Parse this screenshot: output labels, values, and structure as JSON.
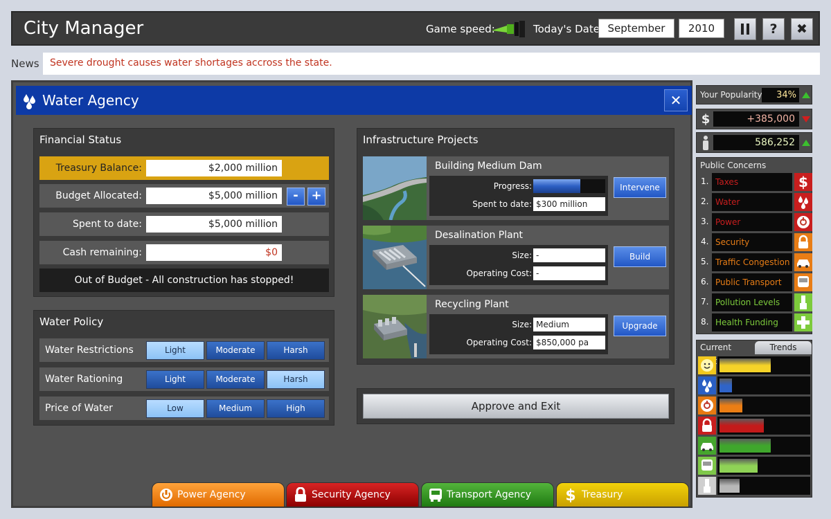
{
  "header": {
    "title": "City Manager",
    "speed_label": "Game speed:",
    "date_label": "Today's Date:",
    "month": "September",
    "year": "2010",
    "pause_icon": "pause-icon",
    "help_label": "?",
    "close_label": "✖"
  },
  "news": {
    "label": "News",
    "text": "Severe drought causes water shortages accross the state."
  },
  "agency": {
    "title": "Water Agency",
    "icon": "water-drops-icon",
    "close_label": "✕",
    "financial": {
      "title": "Financial Status",
      "rows": [
        {
          "label": "Treasury Balance:",
          "value": "$2,000 million"
        },
        {
          "label": "Budget Allocated:",
          "value": "$5,000 million"
        },
        {
          "label": "Spent to date:",
          "value": "$5,000 million"
        },
        {
          "label": "Cash remaining:",
          "value": "$0"
        }
      ],
      "minus_label": "-",
      "plus_label": "+",
      "status_message": "Out of Budget - All construction has stopped!"
    },
    "policy": {
      "title": "Water Policy",
      "rows": [
        {
          "label": "Water Restrictions",
          "options": [
            "Light",
            "Moderate",
            "Harsh"
          ],
          "selected": 0
        },
        {
          "label": "Water Rationing",
          "options": [
            "Light",
            "Moderate",
            "Harsh"
          ],
          "selected": 2
        },
        {
          "label": "Price of Water",
          "options": [
            "Low",
            "Medium",
            "High"
          ],
          "selected": 0
        }
      ]
    },
    "infrastructure": {
      "title": "Infrastructure Projects",
      "projects": [
        {
          "name": "Building Medium Dam",
          "label1": "Progress:",
          "progress": 0.65,
          "label2": "Spent to date:",
          "value2": "$300 million",
          "button": "Intervene"
        },
        {
          "name": "Desalination Plant",
          "label1": "Size:",
          "value1": "-",
          "label2": "Operating Cost:",
          "value2": "-",
          "button": "Build"
        },
        {
          "name": "Recycling Plant",
          "label1": "Size:",
          "value1": "Medium",
          "label2": "Operating Cost:",
          "value2": "$850,000 pa",
          "button": "Upgrade"
        }
      ]
    },
    "approve_label": "Approve and Exit"
  },
  "tabs": [
    {
      "label": "Power Agency",
      "icon": "power-icon"
    },
    {
      "label": "Security Agency",
      "icon": "lock-icon"
    },
    {
      "label": "Transport Agency",
      "icon": "bus-icon"
    },
    {
      "label": "Treasury",
      "icon": "dollar-icon"
    }
  ],
  "sidebar": {
    "popularity_label": "Your Popularity",
    "popularity_value": "34%",
    "popularity_trend": "up",
    "money_value": "+385,000",
    "money_trend": "down",
    "population_value": "586,252",
    "population_trend": "up",
    "concerns_title": "Public Concerns",
    "concerns": [
      {
        "num": "1.",
        "label": "Taxes",
        "color": "#c81e1e",
        "icon": "dollar-icon"
      },
      {
        "num": "2.",
        "label": "Water",
        "color": "#c81e1e",
        "icon": "water-drops-icon"
      },
      {
        "num": "3.",
        "label": "Power",
        "color": "#c81e1e",
        "icon": "power-icon"
      },
      {
        "num": "4.",
        "label": "Security",
        "color": "#e87d16",
        "icon": "lock-icon"
      },
      {
        "num": "5.",
        "label": "Traffic Congestion",
        "color": "#e87d16",
        "icon": "car-icon"
      },
      {
        "num": "6.",
        "label": "Public Transport",
        "color": "#e87d16",
        "icon": "bus-icon"
      },
      {
        "num": "7.",
        "label": "Pollution Levels",
        "color": "#7dcb3c",
        "icon": "factory-icon"
      },
      {
        "num": "8.",
        "label": "Health Funding",
        "color": "#7dcb3c",
        "icon": "health-cross-icon"
      }
    ],
    "status_current_label": "Current Status",
    "status_trends_label": "Trends",
    "status": [
      {
        "icon": "smiley-icon",
        "icon_color": "#f2c81e",
        "level": 0.58,
        "color": "#f5d328"
      },
      {
        "icon": "water-drops-icon",
        "icon_color": "#2a5fc4",
        "level": 0.14,
        "color": "#2f64c9"
      },
      {
        "icon": "power-icon",
        "icon_color": "#e77a12",
        "level": 0.26,
        "color": "#ec7e14"
      },
      {
        "icon": "lock-icon",
        "icon_color": "#c81e1e",
        "level": 0.5,
        "color": "#c41a1a"
      },
      {
        "icon": "car-icon",
        "icon_color": "#46a52e",
        "level": 0.58,
        "color": "#3fa72c"
      },
      {
        "icon": "bus-icon",
        "icon_color": "#7fc84a",
        "level": 0.43,
        "color": "#8fd356"
      },
      {
        "icon": "factory-icon",
        "icon_color": "#cfcfcf",
        "level": 0.23,
        "color": "#b8b8b8"
      }
    ]
  }
}
